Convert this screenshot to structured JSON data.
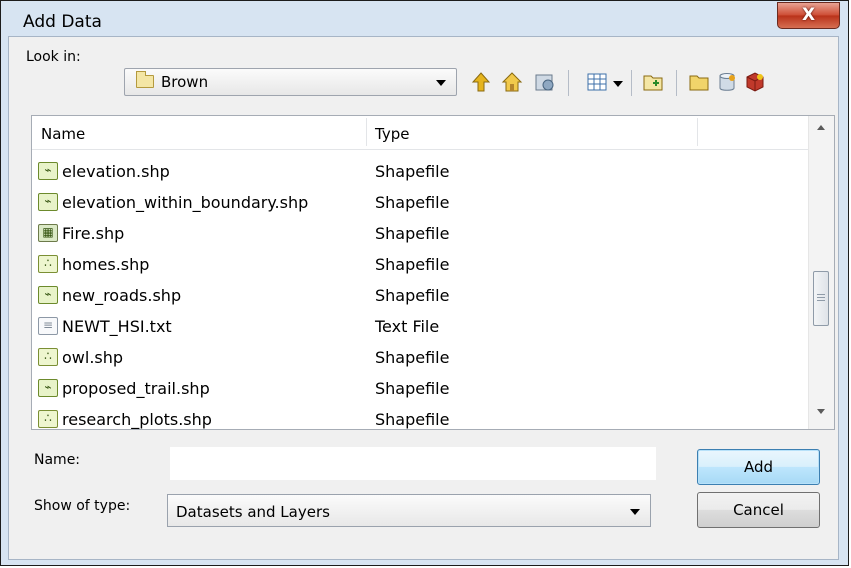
{
  "window": {
    "title": "Add Data",
    "close_glyph": "X"
  },
  "look_in": {
    "label": "Look in:",
    "current": "Brown",
    "icon": "folder-icon"
  },
  "toolbar": {
    "icons": [
      "up-one-level-icon",
      "go-home-icon",
      "toggle-contents-icon",
      "view-menu-icon",
      "connect-to-folder-icon",
      "new-folder-icon",
      "new-file-gdb-icon",
      "new-personal-gdb-icon"
    ]
  },
  "file_list": {
    "columns": [
      "Name",
      "Type"
    ],
    "rows": [
      {
        "name": "elevation.shp",
        "type": "Shapefile",
        "icon": "polyline-shapefile-icon"
      },
      {
        "name": "elevation_within_boundary.shp",
        "type": "Shapefile",
        "icon": "polyline-shapefile-icon"
      },
      {
        "name": "Fire.shp",
        "type": "Shapefile",
        "icon": "polygon-shapefile-icon"
      },
      {
        "name": "homes.shp",
        "type": "Shapefile",
        "icon": "point-shapefile-icon"
      },
      {
        "name": "new_roads.shp",
        "type": "Shapefile",
        "icon": "polyline-shapefile-icon"
      },
      {
        "name": "NEWT_HSI.txt",
        "type": "Text File",
        "icon": "text-file-icon"
      },
      {
        "name": "owl.shp",
        "type": "Shapefile",
        "icon": "point-shapefile-icon"
      },
      {
        "name": "proposed_trail.shp",
        "type": "Shapefile",
        "icon": "polyline-shapefile-icon"
      },
      {
        "name": "research_plots.shp",
        "type": "Shapefile",
        "icon": "point-shapefile-icon"
      }
    ]
  },
  "name_field": {
    "label": "Name:",
    "value": ""
  },
  "show_of_type": {
    "label": "Show of type:",
    "selected": "Datasets and Layers"
  },
  "buttons": {
    "add": "Add",
    "cancel": "Cancel"
  },
  "colors": {
    "title_bar": "#d7e4f2",
    "close_button": "#c84a32",
    "client": "#f0f0f0",
    "default_button": "#bee6fd"
  }
}
